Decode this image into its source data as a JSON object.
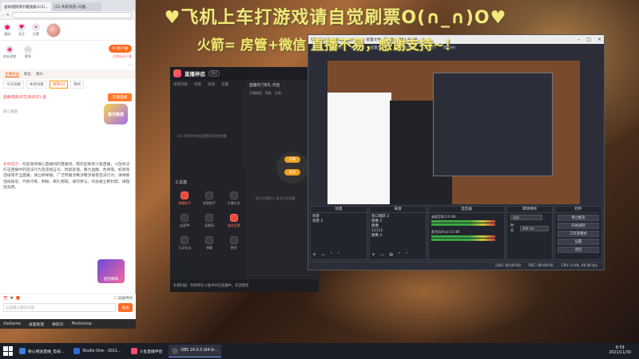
{
  "overlay": {
    "line1": "♥飞机上车打游戏请自觉刷票O(∩_∩)O♥",
    "line2_prefix": "火箭= 房管+微信 直播不易，感谢支持~！"
  },
  "browser": {
    "tabs": [
      "虚拟视频演示播放器(1/2)...",
      "(13 条新消息) 问题..."
    ],
    "icons": [
      {
        "label": "通知",
        "icon": "bell-icon"
      },
      {
        "label": "关注",
        "icon": "heart-icon"
      },
      {
        "label": "位置",
        "icon": "location-icon"
      }
    ],
    "row2": [
      {
        "label": "成长进度",
        "icon": "gamepad-icon"
      },
      {
        "label": "更多",
        "icon": "more-icon"
      }
    ],
    "pc_button": "PC客户端",
    "pc_sub": "立刻自动下载",
    "panel_tabs": [
      "主播权益",
      "粉丝",
      "观众"
    ],
    "sub_tabs": [
      "今日贡献",
      "本周贡献",
      "贵宾(1)",
      "铁杆"
    ],
    "cert_text": "直播/电影/综艺/私房可入直",
    "open_button": "开通直播",
    "hint": "接心相送",
    "sysmsg_label": "系统提示：",
    "sysmsg_body": "欢迎来到接心直播间的直播间，需欢迎来到斗鱼直播，斗鱼依法打击直播中的违法行为及违规言论。封禁处理，暴力血腥、色情等。如发现违规或不当直播，请立即举报，广泛传播涉黄涉赌涉毒等违法行为，请举报违规账号、代练代练、刷粉、刷礼物等，请勿参与。均会被立即封禁，请理性消费。",
    "badge1": "盛光殿堂",
    "badge2": "超然摩羯",
    "bottom_row": [
      "⏰",
      "♥",
      "🎁"
    ],
    "bottom_check": "屏蔽特效",
    "input_placeholder": "这里输入聊天内容",
    "send": "发送",
    "footer": [
      "XieGame",
      "桌面助理",
      "微软识",
      "Photoshop"
    ]
  },
  "helper": {
    "name": "直播伴侣",
    "version": "测试",
    "tabs": [
      "场景列表",
      "场景",
      "添加",
      "设置"
    ],
    "note": "1/6 场景中添加直播源开始直播",
    "right_head": "首播开门有礼 开启",
    "right_sub": [
      "开播规则",
      "帮助",
      "反馈"
    ],
    "pill1": "开播",
    "pill2": "推流",
    "right_note": "暂无开播提示 请先开启直播",
    "tools_title": "工具箱",
    "tools": [
      {
        "label": "弹幕助手",
        "hot": true
      },
      {
        "label": "房管助手",
        "hot": false
      },
      {
        "label": "主播任务",
        "hot": false
      },
      {
        "label": "连麦PK",
        "hot": false
      },
      {
        "label": "直播间",
        "hot": false
      },
      {
        "label": "道具设置",
        "hot": true
      },
      {
        "label": "互动玩法",
        "hot": false
      },
      {
        "label": "弹幕",
        "hot": false
      },
      {
        "label": "更多",
        "hot": false
      }
    ],
    "bottom": "礼物扫描 · 你即将在斗鱼中开启直播中，欢迎使用"
  },
  "obs": {
    "title": "OBS 24.0.3 (64 bit, windows) - 配置文件: 未命名 - 场景: 未命名",
    "menu": [
      "文件(F)",
      "编辑(E)",
      "视图(V)",
      "配置文件(P)",
      "场景集合(S)",
      "工具(T)",
      "帮助(H)"
    ],
    "docks": {
      "scenes": {
        "title": "场景",
        "items": [
          "场景",
          "场景 2"
        ]
      },
      "sources": {
        "title": "来源",
        "items": [
          "窗口捕获 2",
          "图像 2",
          "图像",
          "11111",
          "图像 3"
        ]
      },
      "mixer": {
        "title": "混音器",
        "rows": [
          "桌面音频 0.0 dB",
          "麦克风/Aux 0.0 dB"
        ]
      },
      "transitions": {
        "title": "转场特效",
        "type_label": "淡出",
        "duration_label": "时长",
        "duration_value": "300 ms"
      },
      "controls": {
        "title": "控件",
        "buttons": [
          "停止推流",
          "开始录制",
          "工作室模式",
          "设置",
          "退出"
        ]
      }
    },
    "status": [
      "LIVE: 00:00:00",
      "REC: 00:00:00",
      "CPU: 0.4%, 40.00 fps"
    ]
  },
  "taskbar": {
    "items": [
      {
        "label": "接心相送直播_电视...",
        "active": false
      },
      {
        "label": "Studio One - 2011...",
        "active": false
      },
      {
        "label": "斗鱼直播伴侣",
        "active": false
      },
      {
        "label": "OBS 24.0.3 (64 bi...",
        "active": true
      }
    ],
    "time": "8:59",
    "date": "2021/11/30"
  }
}
